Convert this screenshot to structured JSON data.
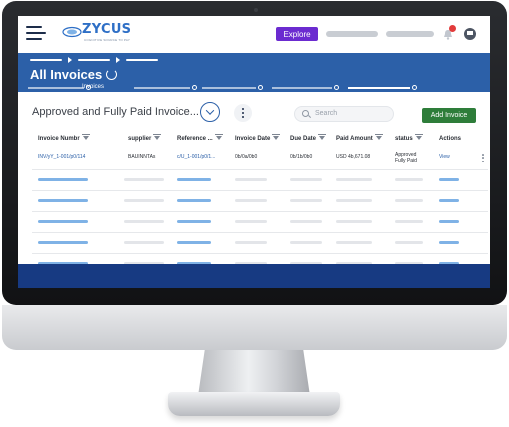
{
  "topbar": {
    "logo_text": "ZYCUS",
    "logo_tagline": "COGNITIVE SOURCE TO PAY",
    "explore_label": "Explore",
    "colors": {
      "explore": "#6b2bd0",
      "logo": "#2e6fc6",
      "badge": "#e23b3b"
    }
  },
  "header": {
    "title": "All Invoices",
    "active_subtab": "Invoices",
    "color": "#2c60a8"
  },
  "toolbar": {
    "list_title": "Approved and Fully Paid Invoice...",
    "search_placeholder": "Search",
    "add_label": "Add Invoice",
    "add_color": "#2e7d3a"
  },
  "table": {
    "columns": [
      "Invoice Numbr",
      "supplier",
      "Reference ...",
      "Invoice Date",
      "Due Date",
      "Paid Amount",
      "status",
      "Actions"
    ],
    "first_row": {
      "invoice_number": "INV/yY_1-001/p0/114",
      "supplier": "BAUINNTAs",
      "reference": "c/U_1-001/p0/1...",
      "invoice_date": "0b/0a/0b0",
      "due_date": "0b/1b/0b0",
      "paid_amount": "USD 4b,671.08",
      "status_line1": "Approved",
      "status_line2": "Fully Paid",
      "action": "View"
    }
  },
  "footer": {
    "color": "#173a82"
  }
}
